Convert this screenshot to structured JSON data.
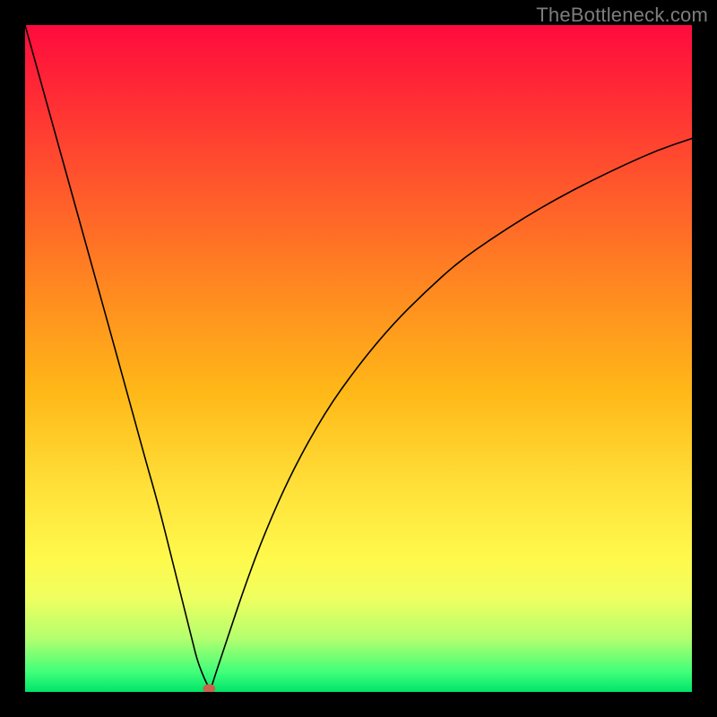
{
  "watermark": {
    "text": "TheBottleneck.com"
  },
  "chart_data": {
    "type": "line",
    "title": "",
    "xlabel": "",
    "ylabel": "",
    "xlim": [
      0,
      100
    ],
    "ylim": [
      0,
      100
    ],
    "grid": false,
    "series": [
      {
        "name": "bottleneck-curve",
        "x": [
          0,
          5,
          10,
          15,
          18,
          20,
          22,
          24,
          25,
          26,
          27.8,
          28,
          30,
          33,
          36,
          40,
          45,
          50,
          55,
          60,
          65,
          70,
          75,
          80,
          85,
          90,
          95,
          100
        ],
        "values": [
          100,
          82,
          64,
          46,
          35,
          28,
          20,
          12,
          8,
          4,
          0,
          1,
          7,
          16,
          24,
          33,
          42,
          49,
          55,
          60,
          64.5,
          68,
          71.2,
          74.1,
          76.7,
          79.1,
          81.3,
          83
        ]
      }
    ],
    "marker": {
      "x": 27.6,
      "y": 0.5,
      "color": "#c9634e"
    },
    "background_gradient": {
      "stops": [
        {
          "pos": 0,
          "color": "#ff0b3e"
        },
        {
          "pos": 10,
          "color": "#ff2a35"
        },
        {
          "pos": 25,
          "color": "#ff5a2b"
        },
        {
          "pos": 40,
          "color": "#ff8a20"
        },
        {
          "pos": 55,
          "color": "#ffb818"
        },
        {
          "pos": 70,
          "color": "#ffe23a"
        },
        {
          "pos": 80,
          "color": "#fff94c"
        },
        {
          "pos": 86,
          "color": "#efff60"
        },
        {
          "pos": 92,
          "color": "#b3ff6e"
        },
        {
          "pos": 97,
          "color": "#41ff7a"
        },
        {
          "pos": 100,
          "color": "#00e46a"
        }
      ]
    }
  }
}
